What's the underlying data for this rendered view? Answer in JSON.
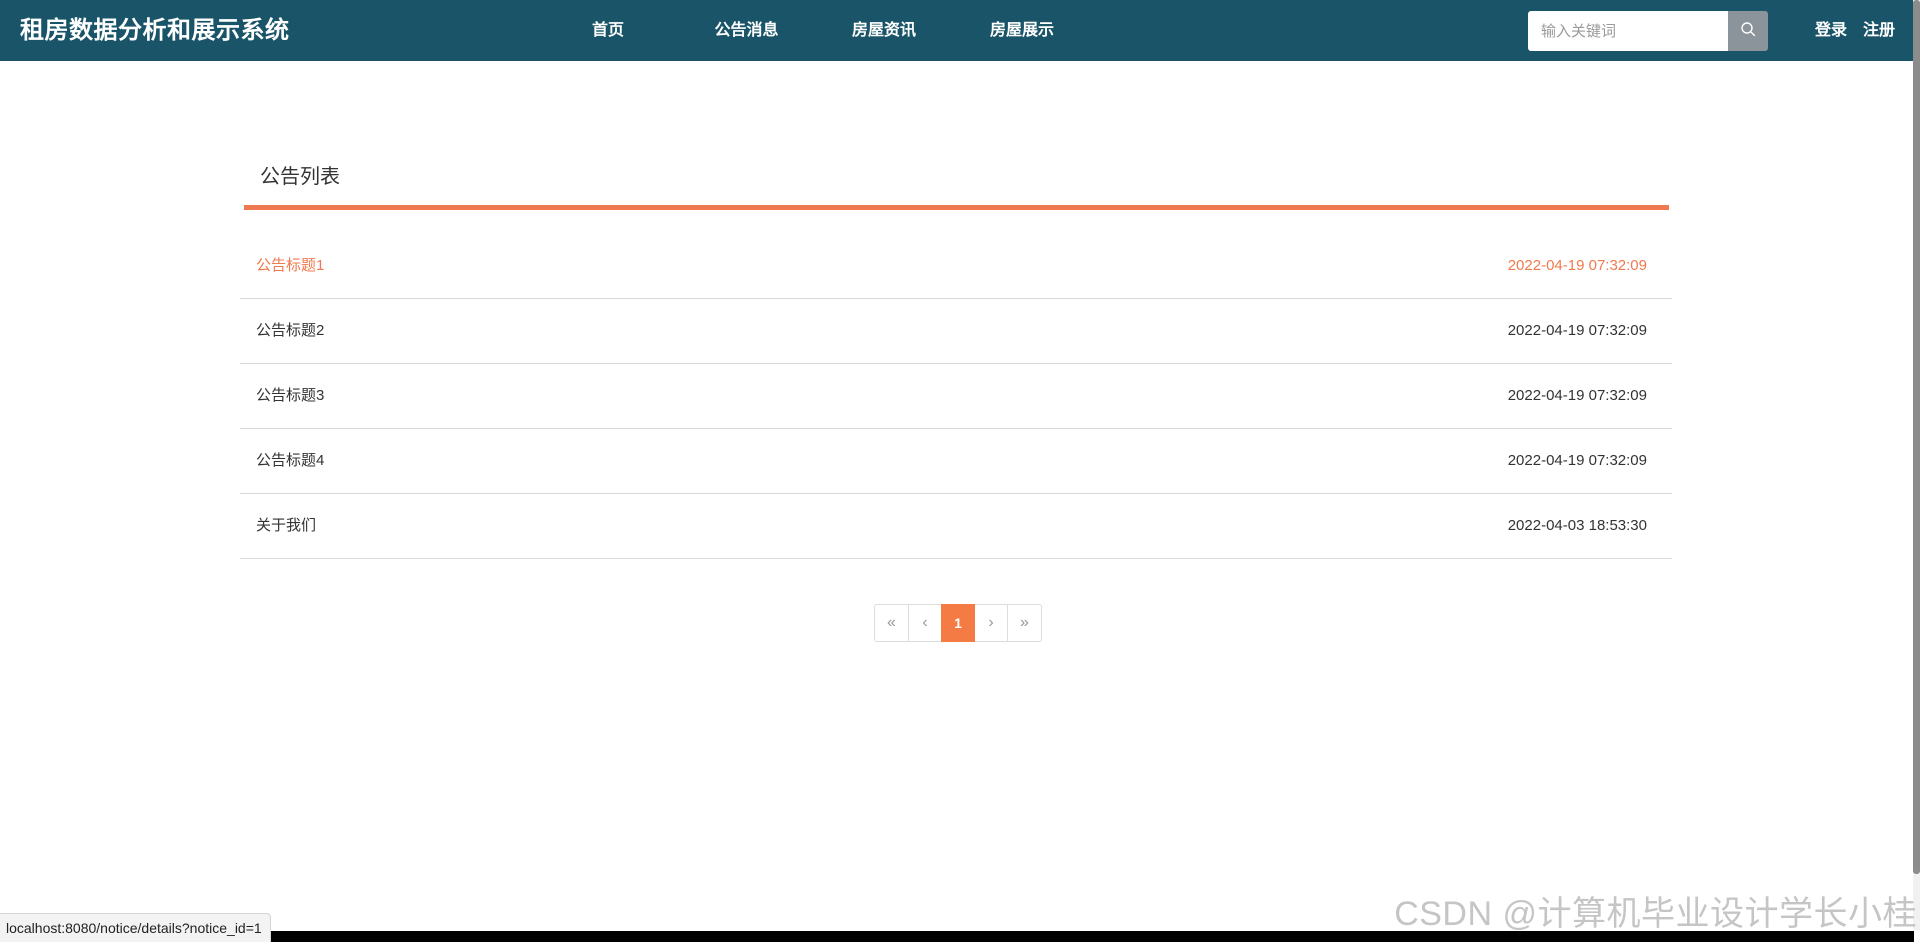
{
  "header": {
    "site_title": "租房数据分析和展示系统",
    "nav": [
      {
        "label": "首页"
      },
      {
        "label": "公告消息"
      },
      {
        "label": "房屋资讯"
      },
      {
        "label": "房屋展示"
      }
    ],
    "search": {
      "placeholder": "输入关键词",
      "value": "",
      "icon": "search-icon"
    },
    "login_label": "登录",
    "register_label": "注册"
  },
  "notice_section": {
    "title": "公告列表",
    "accent_color": "#f07a4f",
    "items": [
      {
        "title": "公告标题1",
        "time": "2022-04-19 07:32:09",
        "hovered": true
      },
      {
        "title": "公告标题2",
        "time": "2022-04-19 07:32:09"
      },
      {
        "title": "公告标题3",
        "time": "2022-04-19 07:32:09"
      },
      {
        "title": "公告标题4",
        "time": "2022-04-19 07:32:09"
      },
      {
        "title": "关于我们",
        "time": "2022-04-03 18:53:30"
      }
    ]
  },
  "pagination": {
    "first": "«",
    "prev": "‹",
    "current": "1",
    "next": "›",
    "last": "»"
  },
  "status_bar": {
    "url": "localhost:8080/notice/details?notice_id=1"
  },
  "watermark": "CSDN @计算机毕业设计学长小桂",
  "colors": {
    "header_bg": "#1a5468",
    "accent": "#f07a4f",
    "page_current_bg": "#f57b45"
  }
}
